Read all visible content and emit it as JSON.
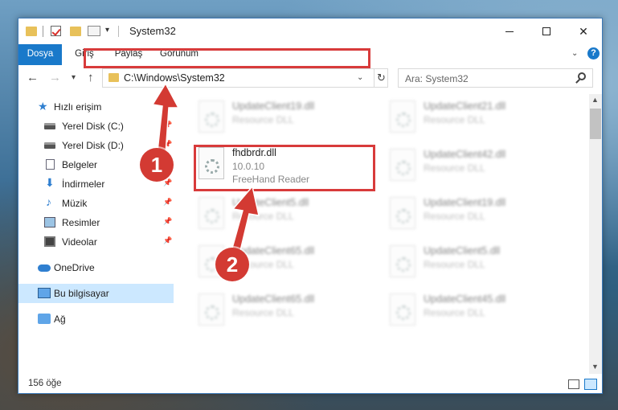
{
  "titlebar": {
    "title": "System32"
  },
  "ribbon": {
    "tabs": [
      "Dosya",
      "Giriş",
      "Paylaş",
      "Görünüm"
    ],
    "help": "?"
  },
  "navbar": {
    "address": "C:\\Windows\\System32",
    "search_placeholder": "Ara: System32"
  },
  "sidebar": {
    "items": [
      {
        "label": "Hızlı erişim",
        "icon": "star-icon"
      },
      {
        "label": "Yerel Disk (C:)",
        "icon": "disk-icon"
      },
      {
        "label": "Yerel Disk (D:)",
        "icon": "disk-icon"
      },
      {
        "label": "Belgeler",
        "icon": "documents-icon"
      },
      {
        "label": "İndirmeler",
        "icon": "download-icon"
      },
      {
        "label": "Müzik",
        "icon": "music-icon"
      },
      {
        "label": "Resimler",
        "icon": "pictures-icon"
      },
      {
        "label": "Videolar",
        "icon": "videos-icon"
      },
      {
        "label": "OneDrive",
        "icon": "cloud-icon"
      },
      {
        "label": "Bu bilgisayar",
        "icon": "pc-icon"
      },
      {
        "label": "Ağ",
        "icon": "network-icon"
      }
    ]
  },
  "files": {
    "left": [
      {
        "name": "UpdateClient19.dll",
        "desc": "Resource DLL"
      },
      {
        "name": "fhdbrdr.dll",
        "version": "10.0.10",
        "desc": "FreeHand Reader"
      },
      {
        "name": "UpdateClient5.dll",
        "desc": "Resource DLL"
      },
      {
        "name": "UpdateClient65.dll",
        "desc": "Resource DLL"
      },
      {
        "name": "UpdateClient65.dll",
        "desc": "Resource DLL"
      }
    ],
    "right": [
      {
        "name": "UpdateClient21.dll",
        "desc": "Resource DLL"
      },
      {
        "name": "UpdateClient42.dll",
        "desc": "Resource DLL"
      },
      {
        "name": "UpdateClient19.dll",
        "desc": "Resource DLL"
      },
      {
        "name": "UpdateClient5.dll",
        "desc": "Resource DLL"
      },
      {
        "name": "UpdateClient45.dll",
        "desc": "Resource DLL"
      }
    ]
  },
  "status": {
    "count": "156 öğe"
  },
  "annotations": {
    "badge1": "1",
    "badge2": "2",
    "color": "#d33a33"
  }
}
